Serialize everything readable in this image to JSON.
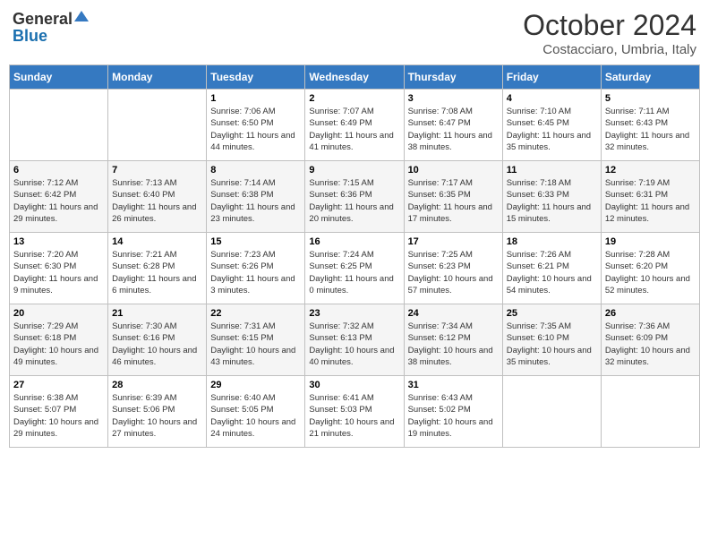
{
  "header": {
    "logo_general": "General",
    "logo_blue": "Blue",
    "month_year": "October 2024",
    "location": "Costacciaro, Umbria, Italy"
  },
  "days_of_week": [
    "Sunday",
    "Monday",
    "Tuesday",
    "Wednesday",
    "Thursday",
    "Friday",
    "Saturday"
  ],
  "weeks": [
    [
      {
        "day": "",
        "sunrise": "",
        "sunset": "",
        "daylight": ""
      },
      {
        "day": "",
        "sunrise": "",
        "sunset": "",
        "daylight": ""
      },
      {
        "day": "1",
        "sunrise": "Sunrise: 7:06 AM",
        "sunset": "Sunset: 6:50 PM",
        "daylight": "Daylight: 11 hours and 44 minutes."
      },
      {
        "day": "2",
        "sunrise": "Sunrise: 7:07 AM",
        "sunset": "Sunset: 6:49 PM",
        "daylight": "Daylight: 11 hours and 41 minutes."
      },
      {
        "day": "3",
        "sunrise": "Sunrise: 7:08 AM",
        "sunset": "Sunset: 6:47 PM",
        "daylight": "Daylight: 11 hours and 38 minutes."
      },
      {
        "day": "4",
        "sunrise": "Sunrise: 7:10 AM",
        "sunset": "Sunset: 6:45 PM",
        "daylight": "Daylight: 11 hours and 35 minutes."
      },
      {
        "day": "5",
        "sunrise": "Sunrise: 7:11 AM",
        "sunset": "Sunset: 6:43 PM",
        "daylight": "Daylight: 11 hours and 32 minutes."
      }
    ],
    [
      {
        "day": "6",
        "sunrise": "Sunrise: 7:12 AM",
        "sunset": "Sunset: 6:42 PM",
        "daylight": "Daylight: 11 hours and 29 minutes."
      },
      {
        "day": "7",
        "sunrise": "Sunrise: 7:13 AM",
        "sunset": "Sunset: 6:40 PM",
        "daylight": "Daylight: 11 hours and 26 minutes."
      },
      {
        "day": "8",
        "sunrise": "Sunrise: 7:14 AM",
        "sunset": "Sunset: 6:38 PM",
        "daylight": "Daylight: 11 hours and 23 minutes."
      },
      {
        "day": "9",
        "sunrise": "Sunrise: 7:15 AM",
        "sunset": "Sunset: 6:36 PM",
        "daylight": "Daylight: 11 hours and 20 minutes."
      },
      {
        "day": "10",
        "sunrise": "Sunrise: 7:17 AM",
        "sunset": "Sunset: 6:35 PM",
        "daylight": "Daylight: 11 hours and 17 minutes."
      },
      {
        "day": "11",
        "sunrise": "Sunrise: 7:18 AM",
        "sunset": "Sunset: 6:33 PM",
        "daylight": "Daylight: 11 hours and 15 minutes."
      },
      {
        "day": "12",
        "sunrise": "Sunrise: 7:19 AM",
        "sunset": "Sunset: 6:31 PM",
        "daylight": "Daylight: 11 hours and 12 minutes."
      }
    ],
    [
      {
        "day": "13",
        "sunrise": "Sunrise: 7:20 AM",
        "sunset": "Sunset: 6:30 PM",
        "daylight": "Daylight: 11 hours and 9 minutes."
      },
      {
        "day": "14",
        "sunrise": "Sunrise: 7:21 AM",
        "sunset": "Sunset: 6:28 PM",
        "daylight": "Daylight: 11 hours and 6 minutes."
      },
      {
        "day": "15",
        "sunrise": "Sunrise: 7:23 AM",
        "sunset": "Sunset: 6:26 PM",
        "daylight": "Daylight: 11 hours and 3 minutes."
      },
      {
        "day": "16",
        "sunrise": "Sunrise: 7:24 AM",
        "sunset": "Sunset: 6:25 PM",
        "daylight": "Daylight: 11 hours and 0 minutes."
      },
      {
        "day": "17",
        "sunrise": "Sunrise: 7:25 AM",
        "sunset": "Sunset: 6:23 PM",
        "daylight": "Daylight: 10 hours and 57 minutes."
      },
      {
        "day": "18",
        "sunrise": "Sunrise: 7:26 AM",
        "sunset": "Sunset: 6:21 PM",
        "daylight": "Daylight: 10 hours and 54 minutes."
      },
      {
        "day": "19",
        "sunrise": "Sunrise: 7:28 AM",
        "sunset": "Sunset: 6:20 PM",
        "daylight": "Daylight: 10 hours and 52 minutes."
      }
    ],
    [
      {
        "day": "20",
        "sunrise": "Sunrise: 7:29 AM",
        "sunset": "Sunset: 6:18 PM",
        "daylight": "Daylight: 10 hours and 49 minutes."
      },
      {
        "day": "21",
        "sunrise": "Sunrise: 7:30 AM",
        "sunset": "Sunset: 6:16 PM",
        "daylight": "Daylight: 10 hours and 46 minutes."
      },
      {
        "day": "22",
        "sunrise": "Sunrise: 7:31 AM",
        "sunset": "Sunset: 6:15 PM",
        "daylight": "Daylight: 10 hours and 43 minutes."
      },
      {
        "day": "23",
        "sunrise": "Sunrise: 7:32 AM",
        "sunset": "Sunset: 6:13 PM",
        "daylight": "Daylight: 10 hours and 40 minutes."
      },
      {
        "day": "24",
        "sunrise": "Sunrise: 7:34 AM",
        "sunset": "Sunset: 6:12 PM",
        "daylight": "Daylight: 10 hours and 38 minutes."
      },
      {
        "day": "25",
        "sunrise": "Sunrise: 7:35 AM",
        "sunset": "Sunset: 6:10 PM",
        "daylight": "Daylight: 10 hours and 35 minutes."
      },
      {
        "day": "26",
        "sunrise": "Sunrise: 7:36 AM",
        "sunset": "Sunset: 6:09 PM",
        "daylight": "Daylight: 10 hours and 32 minutes."
      }
    ],
    [
      {
        "day": "27",
        "sunrise": "Sunrise: 6:38 AM",
        "sunset": "Sunset: 5:07 PM",
        "daylight": "Daylight: 10 hours and 29 minutes."
      },
      {
        "day": "28",
        "sunrise": "Sunrise: 6:39 AM",
        "sunset": "Sunset: 5:06 PM",
        "daylight": "Daylight: 10 hours and 27 minutes."
      },
      {
        "day": "29",
        "sunrise": "Sunrise: 6:40 AM",
        "sunset": "Sunset: 5:05 PM",
        "daylight": "Daylight: 10 hours and 24 minutes."
      },
      {
        "day": "30",
        "sunrise": "Sunrise: 6:41 AM",
        "sunset": "Sunset: 5:03 PM",
        "daylight": "Daylight: 10 hours and 21 minutes."
      },
      {
        "day": "31",
        "sunrise": "Sunrise: 6:43 AM",
        "sunset": "Sunset: 5:02 PM",
        "daylight": "Daylight: 10 hours and 19 minutes."
      },
      {
        "day": "",
        "sunrise": "",
        "sunset": "",
        "daylight": ""
      },
      {
        "day": "",
        "sunrise": "",
        "sunset": "",
        "daylight": ""
      }
    ]
  ]
}
